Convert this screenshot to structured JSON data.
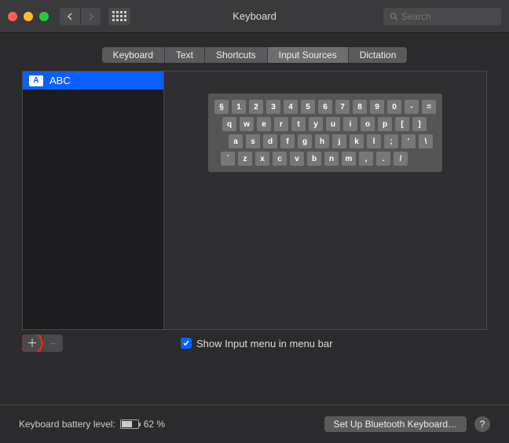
{
  "window": {
    "title": "Keyboard"
  },
  "search": {
    "placeholder": "Search"
  },
  "tabs": [
    {
      "label": "Keyboard",
      "active": false
    },
    {
      "label": "Text",
      "active": false
    },
    {
      "label": "Shortcuts",
      "active": false
    },
    {
      "label": "Input Sources",
      "active": true
    },
    {
      "label": "Dictation",
      "active": false
    }
  ],
  "sources": [
    {
      "label": "ABC",
      "icon_letter": "A",
      "selected": true
    }
  ],
  "keyboard_rows": [
    [
      "§",
      "1",
      "2",
      "3",
      "4",
      "5",
      "6",
      "7",
      "8",
      "9",
      "0",
      "-",
      "="
    ],
    [
      "q",
      "w",
      "e",
      "r",
      "t",
      "y",
      "u",
      "i",
      "o",
      "p",
      "[",
      "]"
    ],
    [
      "a",
      "s",
      "d",
      "f",
      "g",
      "h",
      "j",
      "k",
      "l",
      ";",
      "'",
      "\\"
    ],
    [
      "`",
      "z",
      "x",
      "c",
      "v",
      "b",
      "n",
      "m",
      ",",
      ".",
      "/"
    ]
  ],
  "show_input_menu": {
    "label": "Show Input menu in menu bar",
    "checked": true
  },
  "battery": {
    "label": "Keyboard battery level:",
    "percent_text": "62 %",
    "percent": 62
  },
  "footer": {
    "bluetooth_btn": "Set Up Bluetooth Keyboard…",
    "help": "?"
  }
}
